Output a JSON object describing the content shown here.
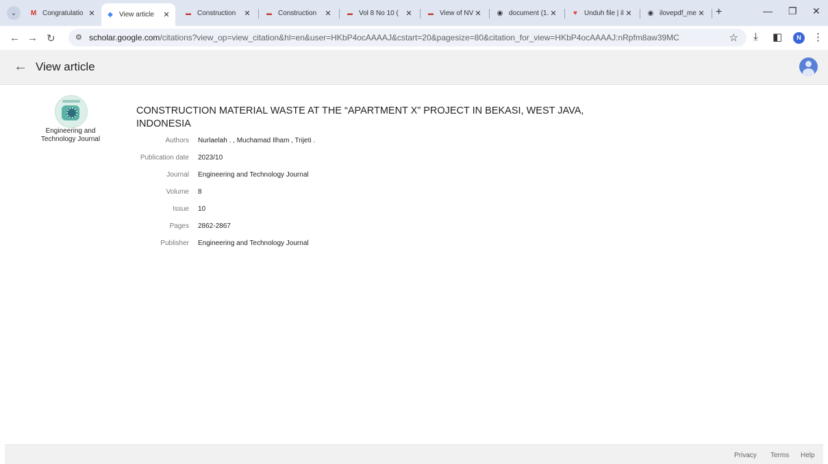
{
  "browser": {
    "tabs": [
      {
        "title": "Congratulatio",
        "favicon": "gmail-icon"
      },
      {
        "title": "View article",
        "favicon": "scholar-icon",
        "active": true
      },
      {
        "title": "Construction",
        "favicon": "journal-icon"
      },
      {
        "title": "Construction",
        "favicon": "journal-icon"
      },
      {
        "title": "Vol 8 No 10 (",
        "favicon": "journal-icon"
      },
      {
        "title": "View of NVA",
        "favicon": "journal-icon"
      },
      {
        "title": "document (1.",
        "favicon": "globe-icon"
      },
      {
        "title": "Unduh file | il",
        "favicon": "heart-icon"
      },
      {
        "title": "ilovepdf_mer",
        "favicon": "globe-icon"
      }
    ],
    "url_host": "scholar.google.com",
    "url_path": "/citations?view_op=view_citation&hl=en&user=HKbP4ocAAAAJ&cstart=20&pagesize=80&citation_for_view=HKbP4ocAAAAJ:nRpfm8aw39MC",
    "profile_initial": "N"
  },
  "header": {
    "title": "View article"
  },
  "journal": {
    "caption": "Engineering and Technology Journal"
  },
  "article": {
    "title": "CONSTRUCTION MATERIAL WASTE AT THE “APARTMENT X” PROJECT IN BEKASI, WEST JAVA, INDONESIA",
    "fields": [
      {
        "label": "Authors",
        "value": "Nurlaelah . ,  Muchamad Ilham ,  Trijeti ."
      },
      {
        "label": "Publication date",
        "value": "2023/10"
      },
      {
        "label": "Journal",
        "value": "Engineering and Technology Journal"
      },
      {
        "label": "Volume",
        "value": "8"
      },
      {
        "label": "Issue",
        "value": "10"
      },
      {
        "label": "Pages",
        "value": "2862-2867"
      },
      {
        "label": "Publisher",
        "value": "Engineering and Technology Journal"
      }
    ]
  },
  "footer": {
    "privacy": "Privacy",
    "terms": "Terms",
    "help": "Help"
  }
}
